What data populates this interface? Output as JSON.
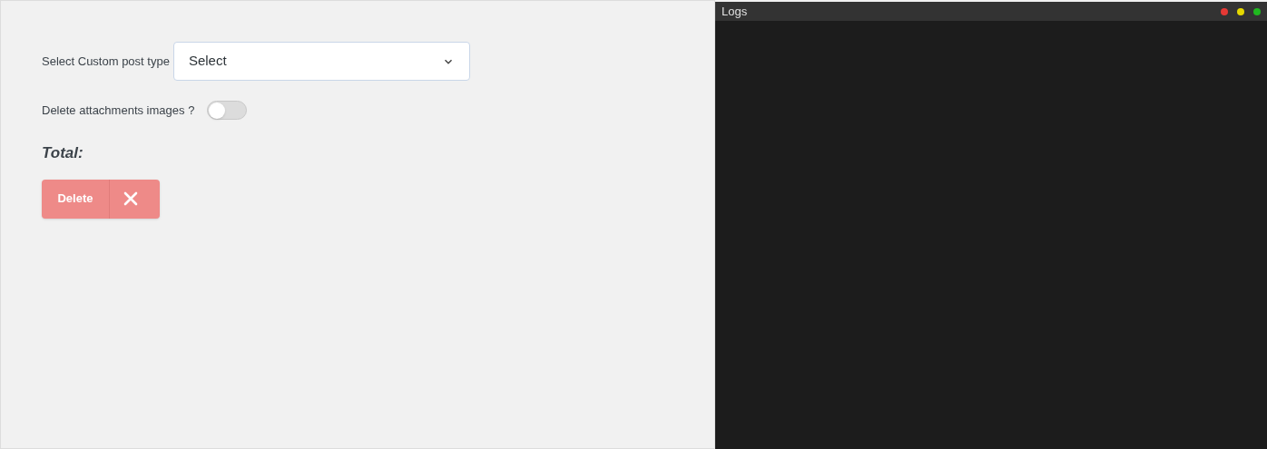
{
  "form": {
    "post_type": {
      "label": "Select Custom post type",
      "value": "Select"
    },
    "delete_attachments": {
      "label": "Delete attachments images ?",
      "on": false
    },
    "total": {
      "label": "Total:"
    },
    "delete_button": {
      "label": "Delete"
    }
  },
  "logs": {
    "title": "Logs",
    "dots": [
      {
        "color": "#e53935"
      },
      {
        "color": "#e5d800"
      },
      {
        "color": "#1fb81f"
      }
    ]
  }
}
